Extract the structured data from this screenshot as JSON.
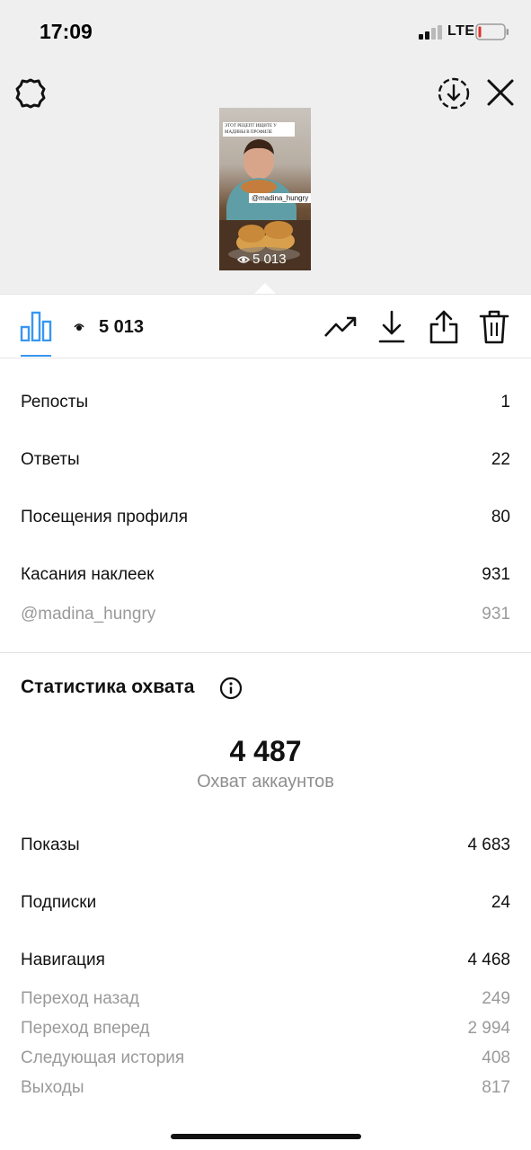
{
  "status_bar": {
    "time": "17:09",
    "network": "LTE"
  },
  "preview": {
    "caption": "ЭТОТ РЕЦЕПТ ИЩИТЕ У МАДИНЫ В ПРОФИЛЕ",
    "mention": "@madina_hungry",
    "views": "5 013"
  },
  "toolbar": {
    "views": "5 013",
    "icons": [
      "bar-chart-icon",
      "eye-icon",
      "trend-icon",
      "download-icon",
      "share-icon",
      "trash-icon"
    ]
  },
  "interactions": [
    {
      "label": "Репосты",
      "value": "1"
    },
    {
      "label": "Ответы",
      "value": "22"
    },
    {
      "label": "Посещения профиля",
      "value": "80"
    },
    {
      "label": "Касания наклеек",
      "value": "931"
    },
    {
      "label": "@madina_hungry",
      "value": "931"
    }
  ],
  "reach": {
    "title": "Статистика охвата",
    "accounts_reached": "4 487",
    "accounts_reached_label": "Охват аккаунтов",
    "rows": [
      {
        "label": "Показы",
        "value": "4 683"
      },
      {
        "label": "Подписки",
        "value": "24"
      },
      {
        "label": "Навигация",
        "value": "4 468"
      }
    ],
    "navigation_details": [
      {
        "label": "Переход назад",
        "value": "249"
      },
      {
        "label": "Переход вперед",
        "value": "2 994"
      },
      {
        "label": "Следующая история",
        "value": "408"
      },
      {
        "label": "Выходы",
        "value": "817"
      }
    ]
  },
  "colors": {
    "accent": "#3897f0",
    "muted_text": "#9a9a9a",
    "header_bg": "#efefef",
    "battery_low": "#e0302a"
  }
}
